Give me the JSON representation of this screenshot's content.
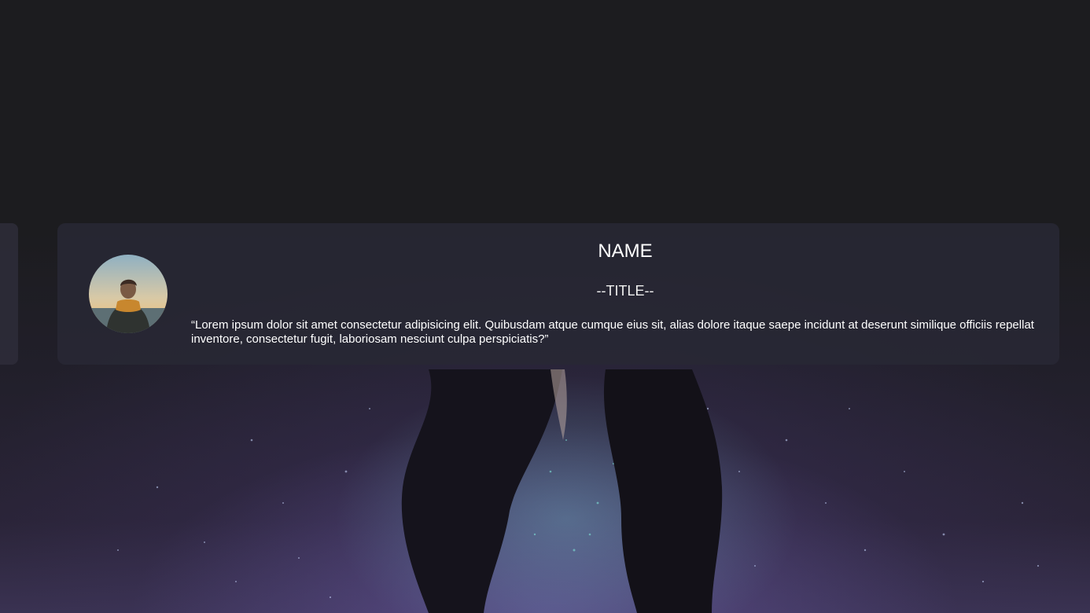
{
  "testimonial": {
    "name": "NAME",
    "title": "--TITLE--",
    "quote": "“Lorem ipsum dolor sit amet consectetur adipisicing elit. Quibusdam atque cumque eius sit, alias dolore itaque saepe incidunt at deserunt similique officiis repellat inventore, consectetur fugit, laboriosam nesciunt culpa perspiciatis?”"
  },
  "colors": {
    "page_background": "#1c1c1f",
    "card_background": "#28283a",
    "text": "#ffffff"
  }
}
